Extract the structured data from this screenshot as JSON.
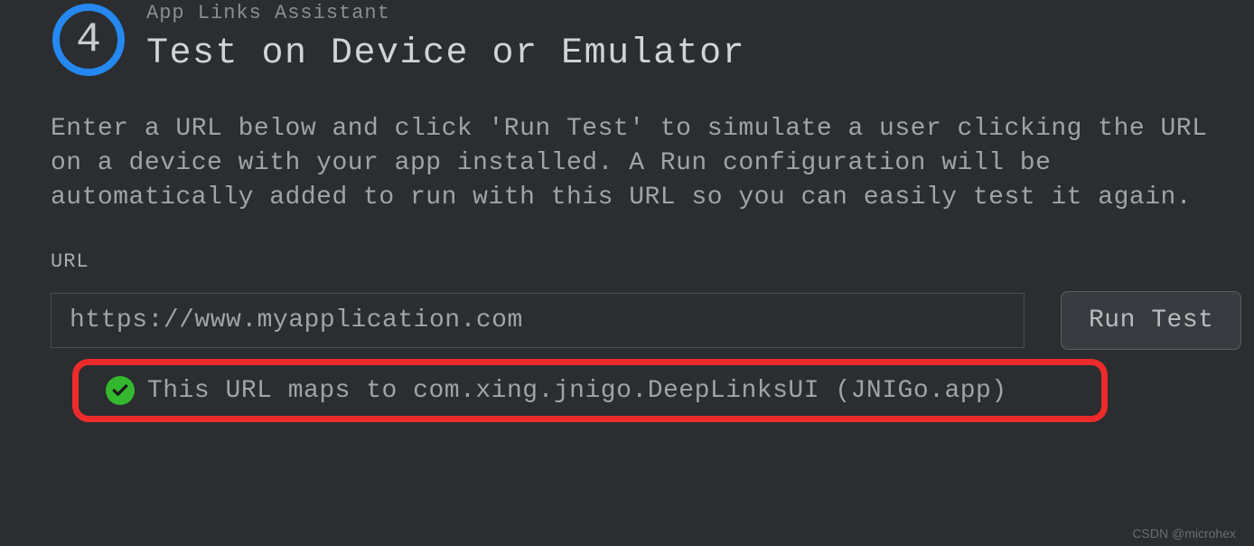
{
  "header": {
    "step_number": "4",
    "breadcrumb": "App Links Assistant",
    "title": "Test on Device or Emulator"
  },
  "description": "Enter a URL below and click 'Run Test' to simulate a user clicking the URL on a device with your app installed. A Run configuration will be automatically added to run with this URL so you can easily test it again.",
  "url_section": {
    "label": "URL",
    "input_value": "https://www.myapplication.com",
    "run_button_label": "Run Test"
  },
  "result": {
    "message": "This URL maps to com.xing.jnigo.DeepLinksUI (JNIGo.app)"
  },
  "watermark": "CSDN @microhex"
}
